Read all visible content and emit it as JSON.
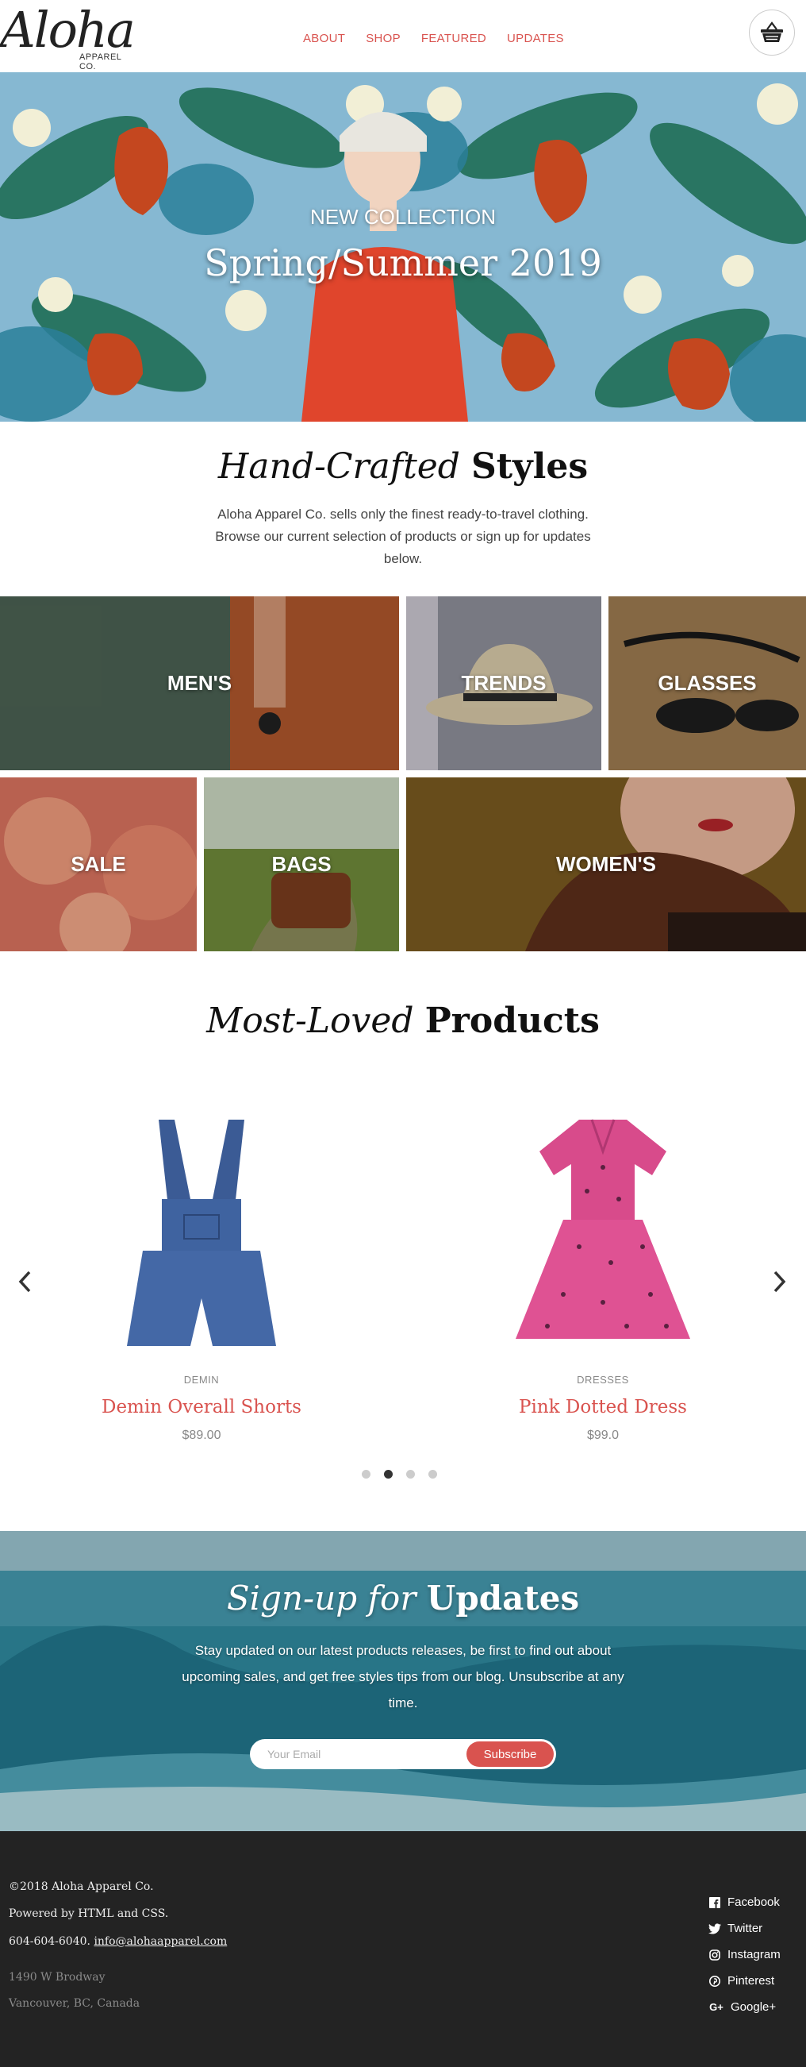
{
  "header": {
    "logo": "Aloha",
    "logo_sub": "APPAREL CO.",
    "nav": [
      "ABOUT",
      "SHOP",
      "FEATURED",
      "UPDATES"
    ],
    "cart_icon": "basket-icon"
  },
  "hero": {
    "eyebrow": "NEW COLLECTION",
    "title": "Spring/Summer 2019"
  },
  "intro": {
    "title_italic": "Hand-Crafted",
    "title_bold": "Styles",
    "text": "Aloha Apparel Co. sells only the finest ready-to-travel clothing. Browse our current selection of products or sign up for updates below."
  },
  "categories": [
    "MEN'S",
    "TRENDS",
    "GLASSES",
    "SALE",
    "BAGS",
    "WOMEN'S"
  ],
  "products_section": {
    "title_italic": "Most-Loved",
    "title_bold": "Products",
    "prev_icon": "chevron-left-icon",
    "next_icon": "chevron-right-icon",
    "items": [
      {
        "category": "DEMIN",
        "name": "Demin Overall Shorts",
        "price": "$89.00"
      },
      {
        "category": "DRESSES",
        "name": "Pink Dotted Dress",
        "price": "$99.0"
      }
    ],
    "carousel_pages": 4,
    "carousel_active": 2
  },
  "signup": {
    "title_italic": "Sign-up for",
    "title_bold": "Updates",
    "text": "Stay updated on our latest products releases, be first to find out about upcoming sales, and get free styles tips from our blog. Unsubscribe at any time.",
    "placeholder": "Your Email",
    "button": "Subscribe"
  },
  "footer": {
    "copyright": "©2018 Aloha Apparel Co.",
    "powered": "Powered by HTML and CSS.",
    "phone": "604-604-6040.",
    "email": "info@alohaapparel.com",
    "address1": "1490 W Brodway",
    "address2": "Vancouver, BC, Canada",
    "social": [
      {
        "label": "Facebook",
        "icon": "facebook-icon"
      },
      {
        "label": "Twitter",
        "icon": "twitter-icon"
      },
      {
        "label": "Instagram",
        "icon": "instagram-icon"
      },
      {
        "label": "Pinterest",
        "icon": "pinterest-icon"
      },
      {
        "label": "Google+",
        "icon": "google-plus-icon"
      }
    ]
  },
  "colors": {
    "accent": "#d9534f",
    "footer_bg": "#232323"
  }
}
